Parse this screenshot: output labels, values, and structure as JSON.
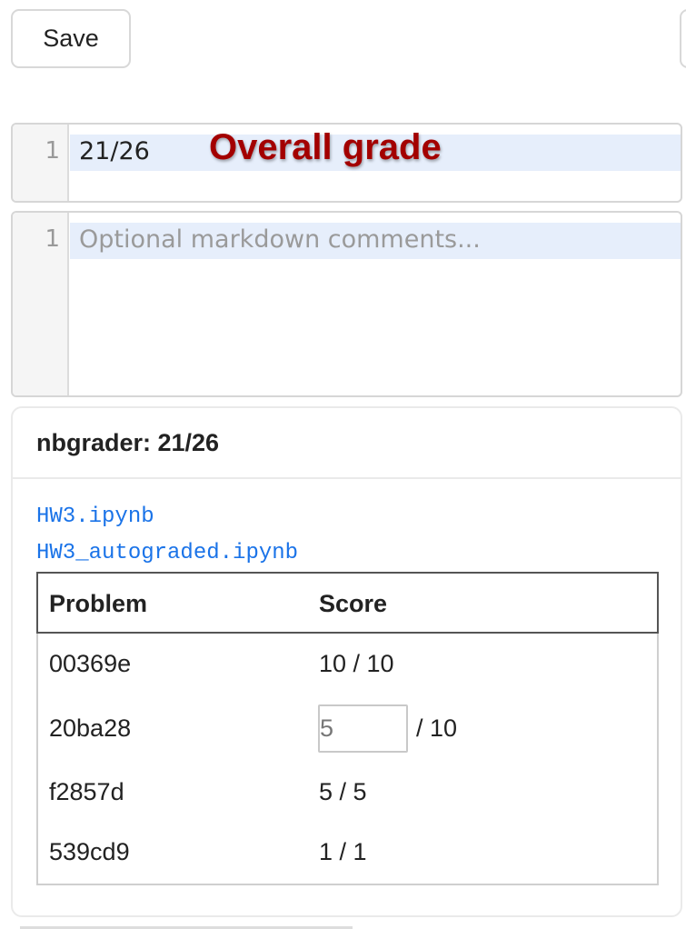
{
  "toolbar": {
    "save_label": "Save"
  },
  "grade_editor": {
    "line_number": "1",
    "value": "21/26"
  },
  "annotation": {
    "text": "Overall grade",
    "color": "#a30000"
  },
  "comments_editor": {
    "line_number": "1",
    "placeholder": "Optional markdown comments..."
  },
  "nbgrader": {
    "title": "nbgrader: 21/26",
    "files": [
      "HW3.ipynb",
      "HW3_autograded.ipynb"
    ],
    "table": {
      "headers": [
        "Problem",
        "Score"
      ],
      "rows": [
        {
          "problem": "00369e",
          "score": "10 / 10"
        },
        {
          "problem": "20ba28",
          "input_placeholder": "5",
          "max": "/ 10"
        },
        {
          "problem": "f2857d",
          "score": "5 / 5"
        },
        {
          "problem": "539cd9",
          "score": "1 / 1"
        }
      ]
    }
  },
  "colors": {
    "link": "#1a73e8",
    "active_line": "#e6eefb",
    "gutter": "#f5f5f5"
  }
}
